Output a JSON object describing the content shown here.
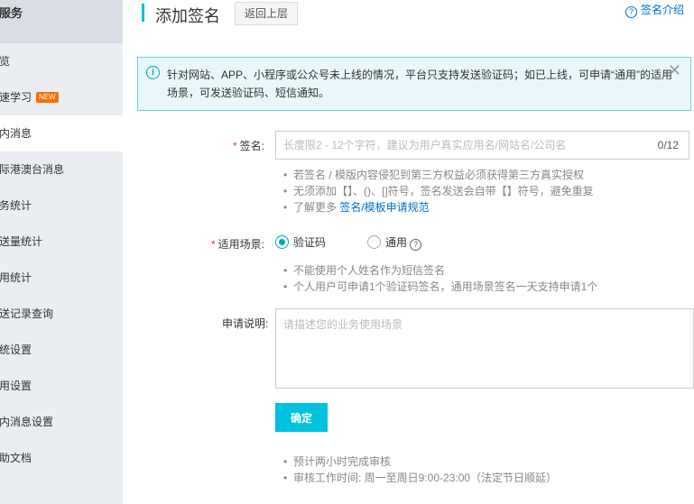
{
  "sidebar": {
    "header": "服务",
    "items": [
      {
        "label": "览",
        "active": false
      },
      {
        "label": "速学习",
        "badge": "NEW",
        "active": false
      },
      {
        "label": "内消息",
        "active": true
      },
      {
        "label": "际港澳台消息",
        "active": false
      },
      {
        "label": "务统计",
        "active": false
      },
      {
        "label": "送量统计",
        "active": false
      },
      {
        "label": "用统计",
        "active": false
      },
      {
        "label": "送记录查询",
        "active": false
      },
      {
        "label": "统设置",
        "active": false
      },
      {
        "label": "用设置",
        "active": false
      },
      {
        "label": "内消息设置",
        "active": false
      },
      {
        "label": "助文档",
        "active": false
      }
    ]
  },
  "header": {
    "title": "添加签名",
    "back_label": "返回上层",
    "help_icon": "question-circle-icon",
    "help_label": "签名介绍"
  },
  "notice": {
    "icon": "info-circle-icon",
    "text": "针对网站、APP、小程序或公众号未上线的情况，平台只支持发送验证码；如已上线，可申请“通用”的适用场景，可发送验证码、短信通知。",
    "close_icon": "close-icon"
  },
  "form": {
    "signature": {
      "required_mark": "*",
      "label": "签名:",
      "placeholder": "长度限2 - 12个字符，建议为用户真实应用名/网站名/公司名",
      "value": "",
      "count": "0/12",
      "hints": [
        "若签名 / 模版内容侵犯到第三方权益必须获得第三方真实授权",
        "无须添加【】、()、[]符号，签名发送会自带【】符号，避免重复"
      ],
      "more_prefix": "了解更多 ",
      "more_link": "签名/模板申请规范"
    },
    "scene": {
      "required_mark": "*",
      "label": "适用场景:",
      "options": [
        {
          "label": "验证码",
          "checked": true
        },
        {
          "label": "通用",
          "checked": false
        }
      ],
      "help_icon": "question-circle-icon",
      "hints": [
        "不能使用个人姓名作为短信签名",
        "个人用户可申请1个验证码签名，通用场景签名一天支持申请1个"
      ]
    },
    "description": {
      "label": "申请说明:",
      "placeholder": "请描述您的业务使用场景",
      "value": ""
    },
    "submit_label": "确定",
    "footer_hints": [
      "预计两小时完成审核",
      "审核工作时间: 周一至周日9:00-23:00（法定节日顺延）"
    ]
  },
  "colors": {
    "accent": "#00c1de",
    "link": "#0070cc",
    "required": "#e4393c",
    "badge": "#f66f00",
    "sidebar_bg": "#eaedf1"
  }
}
